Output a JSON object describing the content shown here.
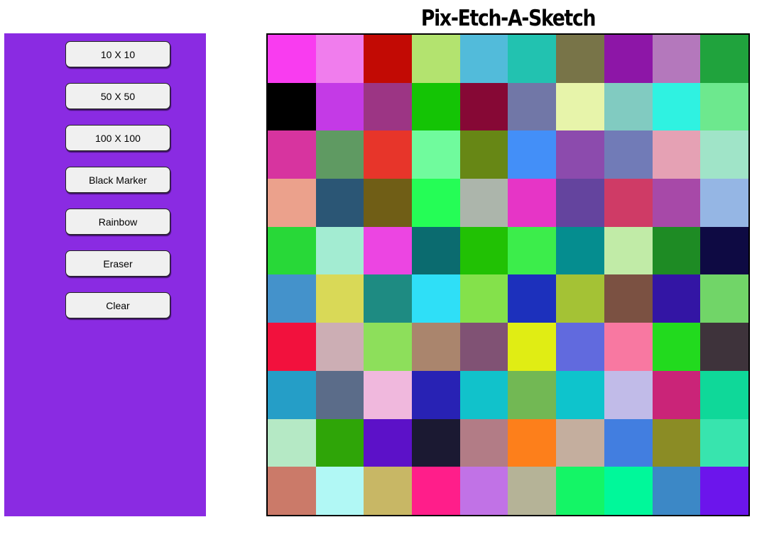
{
  "title": "Pix-Etch-A-Sketch",
  "buttons": [
    {
      "label": "10 X 10",
      "name": "size-10-button"
    },
    {
      "label": "50 X 50",
      "name": "size-50-button"
    },
    {
      "label": "100 X 100",
      "name": "size-100-button"
    },
    {
      "label": "Black Marker",
      "name": "black-marker-button"
    },
    {
      "label": "Rainbow",
      "name": "rainbow-button"
    },
    {
      "label": "Eraser",
      "name": "eraser-button"
    },
    {
      "label": "Clear",
      "name": "clear-button"
    }
  ],
  "colors": {
    "sidebar": "#8a2be2",
    "button_bg": "#f0f0f0"
  },
  "grid": {
    "columns": 10,
    "rows": 10,
    "cells": [
      [
        "#f93cf0",
        "#f07ded",
        "#c20a04",
        "#b3e36f",
        "#52bbda",
        "#22c2b0",
        "#787448",
        "#8d16a7",
        "#b478bc",
        "#20a33d"
      ],
      [
        "#000000",
        "#c43ae6",
        "#9c3584",
        "#14c405",
        "#860835",
        "#7177a7",
        "#e7f4aa",
        "#81cbc1",
        "#2ff2e1",
        "#6de88e"
      ],
      [
        "#d7349f",
        "#5f9a62",
        "#e7352a",
        "#70fb9d",
        "#678715",
        "#438ff8",
        "#8c4bad",
        "#717bb7",
        "#e5a1b4",
        "#a0e4c8"
      ],
      [
        "#eba18c",
        "#2b5675",
        "#705e16",
        "#25fd56",
        "#acb5ab",
        "#e635c6",
        "#64449e",
        "#cf3b66",
        "#a749a8",
        "#95b6e4"
      ],
      [
        "#28d838",
        "#a3ecd2",
        "#ec45e2",
        "#0b6b6f",
        "#21c104",
        "#3ced4b",
        "#058d8f",
        "#c1eba7",
        "#1e8b24",
        "#0e0a43"
      ],
      [
        "#4492cb",
        "#d9d957",
        "#1e8b82",
        "#2fdff7",
        "#84e14b",
        "#1c30bc",
        "#a4c235",
        "#7b5142",
        "#3315a4",
        "#71d568"
      ],
      [
        "#f2113d",
        "#ccaeb4",
        "#8ddf5b",
        "#aa856d",
        "#805274",
        "#e0ed14",
        "#616ade",
        "#f878a1",
        "#22da1e",
        "#3e333b"
      ],
      [
        "#259ec7",
        "#5b6c89",
        "#f0b8dd",
        "#2822b4",
        "#11c2cb",
        "#72b854",
        "#0ec4cc",
        "#c1bbe8",
        "#ca2478",
        "#0fd899"
      ],
      [
        "#b5e9c5",
        "#2fa508",
        "#5c11c8",
        "#1b1932",
        "#b27c86",
        "#fd7f1b",
        "#c4ae9e",
        "#427ee0",
        "#8b8c25",
        "#38e4ae"
      ],
      [
        "#cb7a69",
        "#b1f8f5",
        "#c8b765",
        "#ff1e8a",
        "#c172e6",
        "#b5b397",
        "#14f566",
        "#00f89a",
        "#3c88c6",
        "#6c15ec"
      ]
    ]
  }
}
